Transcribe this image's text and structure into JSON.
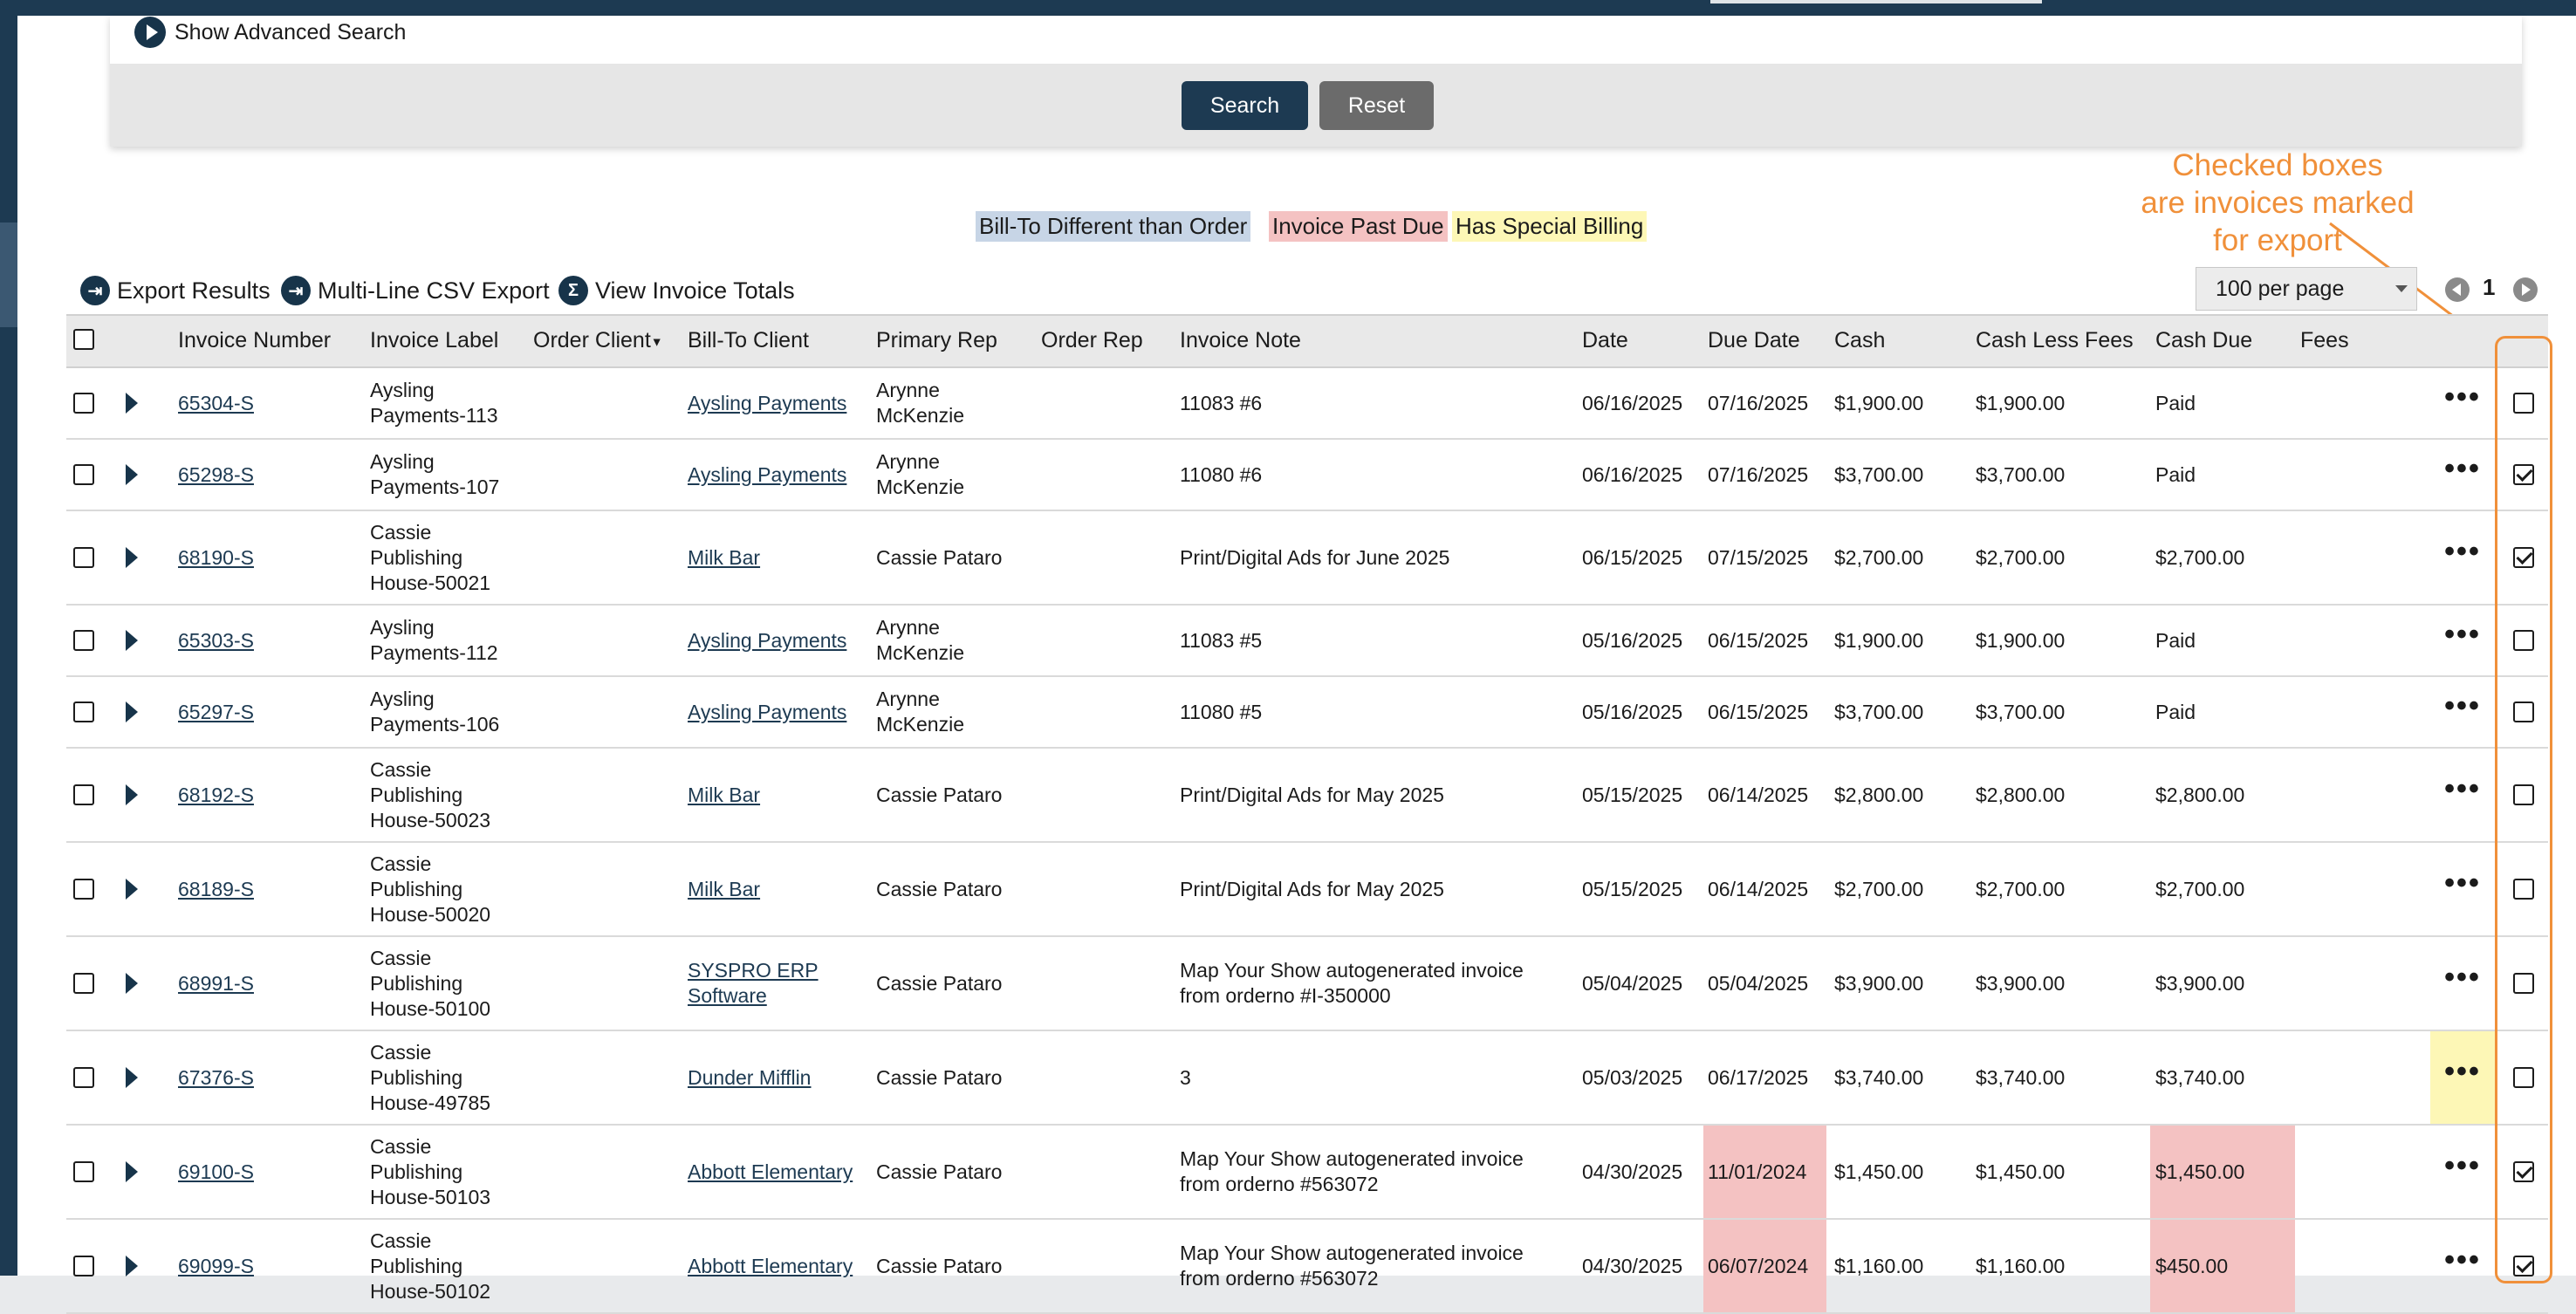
{
  "search_panel": {
    "advanced_label": "Show Advanced Search",
    "search_button": "Search",
    "reset_button": "Reset"
  },
  "legend": {
    "bill_to_different": "Bill-To Different than Order",
    "past_due": "Invoice Past Due",
    "special_billing": "Has Special Billing"
  },
  "annotation": {
    "line1": "Checked boxes",
    "line2": "are invoices marked",
    "line3": "for export",
    "color": "#f0903a"
  },
  "toolbar": {
    "export_results": "Export Results",
    "multi_line_csv": "Multi-Line CSV Export",
    "view_totals": "View Invoice Totals"
  },
  "pagination": {
    "per_page": "100 per page",
    "page": "1"
  },
  "columns": {
    "invoice_number": "Invoice Number",
    "invoice_label": "Invoice Label",
    "order_client": "Order Client",
    "bill_to_client": "Bill-To Client",
    "primary_rep": "Primary Rep",
    "order_rep": "Order Rep",
    "invoice_note": "Invoice Note",
    "date": "Date",
    "due_date": "Due Date",
    "cash": "Cash",
    "cash_less_fees": "Cash Less Fees",
    "cash_due": "Cash Due",
    "fees": "Fees"
  },
  "rows": [
    {
      "number": "65304-S",
      "label": [
        "Aysling",
        "Payments-113"
      ],
      "bill_to": [
        "Aysling Payments"
      ],
      "rep": [
        "Arynne",
        "McKenzie"
      ],
      "note": [
        "11083 #6"
      ],
      "date": "06/16/2025",
      "due": "07/16/2025",
      "cash": "$1,900.00",
      "cash_less": "$1,900.00",
      "cash_due": "Paid",
      "export": false,
      "past_due": false,
      "special": false,
      "cash_due_red": false
    },
    {
      "number": "65298-S",
      "label": [
        "Aysling",
        "Payments-107"
      ],
      "bill_to": [
        "Aysling Payments"
      ],
      "rep": [
        "Arynne",
        "McKenzie"
      ],
      "note": [
        "11080 #6"
      ],
      "date": "06/16/2025",
      "due": "07/16/2025",
      "cash": "$3,700.00",
      "cash_less": "$3,700.00",
      "cash_due": "Paid",
      "export": true,
      "past_due": false,
      "special": false,
      "cash_due_red": false
    },
    {
      "number": "68190-S",
      "label": [
        "Cassie",
        "Publishing",
        "House-50021"
      ],
      "bill_to": [
        "Milk Bar"
      ],
      "rep": [
        "Cassie Pataro"
      ],
      "note": [
        "Print/Digital Ads for June 2025"
      ],
      "date": "06/15/2025",
      "due": "07/15/2025",
      "cash": "$2,700.00",
      "cash_less": "$2,700.00",
      "cash_due": "$2,700.00",
      "export": true,
      "past_due": false,
      "special": false,
      "cash_due_red": false
    },
    {
      "number": "65303-S",
      "label": [
        "Aysling",
        "Payments-112"
      ],
      "bill_to": [
        "Aysling Payments"
      ],
      "rep": [
        "Arynne",
        "McKenzie"
      ],
      "note": [
        "11083 #5"
      ],
      "date": "05/16/2025",
      "due": "06/15/2025",
      "cash": "$1,900.00",
      "cash_less": "$1,900.00",
      "cash_due": "Paid",
      "export": false,
      "past_due": false,
      "special": false,
      "cash_due_red": false
    },
    {
      "number": "65297-S",
      "label": [
        "Aysling",
        "Payments-106"
      ],
      "bill_to": [
        "Aysling Payments"
      ],
      "rep": [
        "Arynne",
        "McKenzie"
      ],
      "note": [
        "11080 #5"
      ],
      "date": "05/16/2025",
      "due": "06/15/2025",
      "cash": "$3,700.00",
      "cash_less": "$3,700.00",
      "cash_due": "Paid",
      "export": false,
      "past_due": false,
      "special": false,
      "cash_due_red": false
    },
    {
      "number": "68192-S",
      "label": [
        "Cassie",
        "Publishing",
        "House-50023"
      ],
      "bill_to": [
        "Milk Bar"
      ],
      "rep": [
        "Cassie Pataro"
      ],
      "note": [
        "Print/Digital Ads for May 2025"
      ],
      "date": "05/15/2025",
      "due": "06/14/2025",
      "cash": "$2,800.00",
      "cash_less": "$2,800.00",
      "cash_due": "$2,800.00",
      "export": false,
      "past_due": false,
      "special": false,
      "cash_due_red": false
    },
    {
      "number": "68189-S",
      "label": [
        "Cassie",
        "Publishing",
        "House-50020"
      ],
      "bill_to": [
        "Milk Bar"
      ],
      "rep": [
        "Cassie Pataro"
      ],
      "note": [
        "Print/Digital Ads for May 2025"
      ],
      "date": "05/15/2025",
      "due": "06/14/2025",
      "cash": "$2,700.00",
      "cash_less": "$2,700.00",
      "cash_due": "$2,700.00",
      "export": false,
      "past_due": false,
      "special": false,
      "cash_due_red": false
    },
    {
      "number": "68991-S",
      "label": [
        "Cassie",
        "Publishing",
        "House-50100"
      ],
      "bill_to": [
        "SYSPRO ERP",
        "Software"
      ],
      "rep": [
        "Cassie Pataro"
      ],
      "note": [
        "Map Your Show autogenerated invoice",
        "from orderno #I-350000"
      ],
      "date": "05/04/2025",
      "due": "05/04/2025",
      "cash": "$3,900.00",
      "cash_less": "$3,900.00",
      "cash_due": "$3,900.00",
      "export": false,
      "past_due": false,
      "special": false,
      "cash_due_red": false
    },
    {
      "number": "67376-S",
      "label": [
        "Cassie",
        "Publishing",
        "House-49785"
      ],
      "bill_to": [
        "Dunder Mifflin"
      ],
      "rep": [
        "Cassie Pataro"
      ],
      "note": [
        "3"
      ],
      "date": "05/03/2025",
      "due": "06/17/2025",
      "cash": "$3,740.00",
      "cash_less": "$3,740.00",
      "cash_due": "$3,740.00",
      "export": false,
      "past_due": false,
      "special": true,
      "cash_due_red": false
    },
    {
      "number": "69100-S",
      "label": [
        "Cassie",
        "Publishing",
        "House-50103"
      ],
      "bill_to": [
        "Abbott Elementary"
      ],
      "rep": [
        "Cassie Pataro"
      ],
      "note": [
        "Map Your Show autogenerated invoice",
        "from orderno #563072"
      ],
      "date": "04/30/2025",
      "due": "11/01/2024",
      "cash": "$1,450.00",
      "cash_less": "$1,450.00",
      "cash_due": "$1,450.00",
      "export": true,
      "past_due": true,
      "special": false,
      "cash_due_red": true
    },
    {
      "number": "69099-S",
      "label": [
        "Cassie",
        "Publishing",
        "House-50102"
      ],
      "bill_to": [
        "Abbott Elementary"
      ],
      "rep": [
        "Cassie Pataro"
      ],
      "note": [
        "Map Your Show autogenerated invoice",
        "from orderno #563072"
      ],
      "date": "04/30/2025",
      "due": "06/07/2024",
      "cash": "$1,160.00",
      "cash_less": "$1,160.00",
      "cash_due": "$450.00",
      "export": true,
      "past_due": true,
      "special": false,
      "cash_due_red": true
    }
  ]
}
